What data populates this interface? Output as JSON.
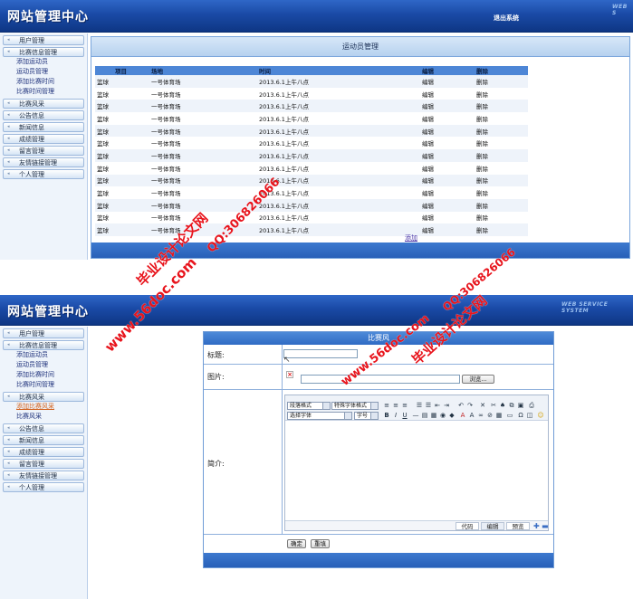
{
  "screen1": {
    "header": {
      "logo": "网站管理中心",
      "exit": "退出系统",
      "ws_text": "WEB S"
    },
    "sidebar": [
      {
        "label": "用户管理",
        "subs": []
      },
      {
        "label": "比赛信息管理",
        "subs": [
          "添加运动员",
          "运动员管理",
          "添加比赛时间",
          "比赛时间管理"
        ]
      },
      {
        "label": "比赛风采",
        "subs": []
      },
      {
        "label": "公告信息",
        "subs": []
      },
      {
        "label": "新闻信息",
        "subs": []
      },
      {
        "label": "成绩管理",
        "subs": []
      },
      {
        "label": "留言管理",
        "subs": []
      },
      {
        "label": "友情链接管理",
        "subs": []
      },
      {
        "label": "个人管理",
        "subs": []
      }
    ],
    "panel_title": "运动员管理",
    "table": {
      "headers": [
        "项目",
        "场地",
        "时间",
        "编辑",
        "删除"
      ],
      "rows": [
        [
          "篮球",
          "一号体育场",
          "2013.6.1上午八点",
          "编辑",
          "删除"
        ],
        [
          "篮球",
          "一号体育场",
          "2013.6.1上午八点",
          "编辑",
          "删除"
        ],
        [
          "篮球",
          "一号体育场",
          "2013.6.1上午八点",
          "编辑",
          "删除"
        ],
        [
          "篮球",
          "一号体育场",
          "2013.6.1上午八点",
          "编辑",
          "删除"
        ],
        [
          "篮球",
          "一号体育场",
          "2013.6.1上午八点",
          "编辑",
          "删除"
        ],
        [
          "篮球",
          "一号体育场",
          "2013.6.1上午八点",
          "编辑",
          "删除"
        ],
        [
          "篮球",
          "一号体育场",
          "2013.6.1上午八点",
          "编辑",
          "删除"
        ],
        [
          "篮球",
          "一号体育场",
          "2013.6.1上午八点",
          "编辑",
          "删除"
        ],
        [
          "篮球",
          "一号体育场",
          "2013.6.1上午八点",
          "编辑",
          "删除"
        ],
        [
          "篮球",
          "一号体育场",
          "2013.6.1上午八点",
          "编辑",
          "删除"
        ],
        [
          "篮球",
          "一号体育场",
          "2013.6.1上午八点",
          "编辑",
          "删除"
        ],
        [
          "篮球",
          "一号体育场",
          "2013.6.1上午八点",
          "编辑",
          "删除"
        ],
        [
          "篮球",
          "一号体育场",
          "2013.6.1上午八点",
          "编辑",
          "删除"
        ]
      ]
    },
    "add_link": "添加"
  },
  "screen2": {
    "header": {
      "logo": "网站管理中心",
      "ws_text": "WEB SERVICE SYSTEM"
    },
    "sidebar": [
      {
        "label": "用户管理",
        "subs": []
      },
      {
        "label": "比赛信息管理",
        "subs": [
          "添加运动员",
          "运动员管理",
          "添加比赛时间",
          "比赛时间管理"
        ]
      },
      {
        "label": "比赛风采",
        "subs": [
          "添加比赛风采",
          "比赛风采"
        ],
        "active_sub": 0
      },
      {
        "label": "公告信息",
        "subs": []
      },
      {
        "label": "新闻信息",
        "subs": []
      },
      {
        "label": "成绩管理",
        "subs": []
      },
      {
        "label": "留言管理",
        "subs": []
      },
      {
        "label": "友情链接管理",
        "subs": []
      },
      {
        "label": "个人管理",
        "subs": []
      }
    ],
    "panel_title": "比赛风",
    "form": {
      "title_label": "标题:",
      "image_label": "图片:",
      "browse": "浏览...",
      "intro_label": "简介:",
      "editor": {
        "sel_paragraph": "段落格式",
        "sel_special": "特殊字体格式",
        "sel_font": "选择字体",
        "sel_size": "字号",
        "tabs": [
          "代码",
          "编辑",
          "预览"
        ]
      },
      "submit": "确定",
      "reset": "重填"
    }
  },
  "watermarks": {
    "site": "www.56doc.com",
    "qq": "QQ:306826066",
    "name": "毕业设计论文网"
  },
  "colors": {
    "header": "#1a4aa6",
    "table_header": "#4d86d6",
    "watermark": "#e8141c",
    "active": "#d2601a"
  }
}
